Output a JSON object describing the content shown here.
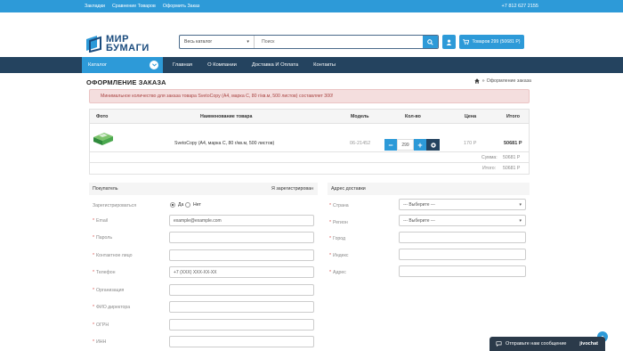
{
  "topbar": {
    "links": [
      "Закладки",
      "Сравнение Товаров",
      "Оформить Заказ"
    ],
    "phone": "+7 812 627 2155"
  },
  "logo": {
    "line1": "МИР",
    "line2": "БУМАГИ"
  },
  "search": {
    "category": "Весь каталог",
    "placeholder": "Поиск"
  },
  "cart_button": {
    "label": "Товаров 299 (50681 Р)"
  },
  "nav": {
    "catalog": "Каталог",
    "items": [
      "Главная",
      "О Компании",
      "Доставка И Оплата",
      "Контакты"
    ]
  },
  "page": {
    "title": "ОФОРМЛЕНИЕ ЗАКАЗА",
    "breadcrumb": "Оформление заказа",
    "breadcrumb_sep": "»"
  },
  "alert": "Минимальное количество для заказа товара SvetoCopy (А4, марка С, 80 г/кв.м, 500 листов) составляет 300!",
  "cart": {
    "headers": {
      "photo": "Фото",
      "name": "Наименование товара",
      "model": "Модель",
      "qty": "Кол-во",
      "price": "Цена",
      "total": "Итого"
    },
    "item": {
      "name": "SvetoCopy (А4, марка С, 80 г/кв.м, 500 листов)",
      "model": "06-21452",
      "qty": "299",
      "price": "170 Р",
      "total": "50681 Р"
    },
    "sum_label": "Сумма:",
    "sum_value": "50681 Р",
    "grand_label": "Итого:",
    "grand_value": "50681 Р"
  },
  "buyer": {
    "title": "Покупатель",
    "registered_link": "Я зарегистрирован",
    "register_label": "Зарегистрироваться",
    "yes": "Да",
    "no": "Нет",
    "email_label": "Email",
    "email_value": "example@example.com",
    "password_label": "Пароль",
    "contact_label": "Контактное лицо",
    "phone_label": "Телефон",
    "phone_value": "+7 (XXX) XXX-XX-XX",
    "org_label": "Организация",
    "director_label": "ФИО директора",
    "ogrn_label": "ОГРН",
    "inn_label": "ИНН"
  },
  "delivery": {
    "title": "Адрес доставки",
    "country_label": "Страна",
    "country_value": "--- Выберите ---",
    "region_label": "Регион",
    "region_value": "--- Выберите ---",
    "city_label": "Город",
    "zip_label": "Индекс",
    "address_label": "Адрес"
  },
  "chat": {
    "label": "Отправьте нам сообщение",
    "brand": "jivochat"
  },
  "colors": {
    "accent": "#2d9ad8",
    "nav": "#24435f",
    "alert_bg": "#f4dede",
    "alert_text": "#a94442"
  }
}
